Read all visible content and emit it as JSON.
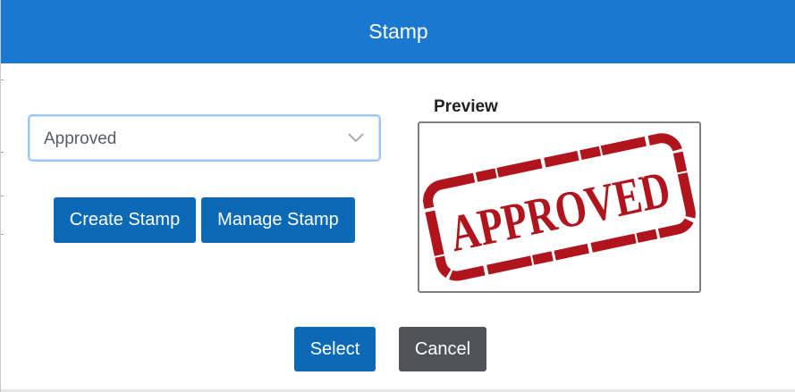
{
  "dialog": {
    "title": "Stamp"
  },
  "stamp_select": {
    "selected": "Approved",
    "icon": "chevron-down-icon"
  },
  "actions": {
    "create_label": "Create Stamp",
    "manage_label": "Manage Stamp"
  },
  "preview": {
    "label": "Preview",
    "stamp_text": "APPROVED",
    "stamp_color": "#b0151d"
  },
  "footer": {
    "select_label": "Select",
    "cancel_label": "Cancel"
  },
  "colors": {
    "header": "#1b78d0",
    "primary_button": "#0b69b5",
    "secondary_button": "#4f5456"
  }
}
